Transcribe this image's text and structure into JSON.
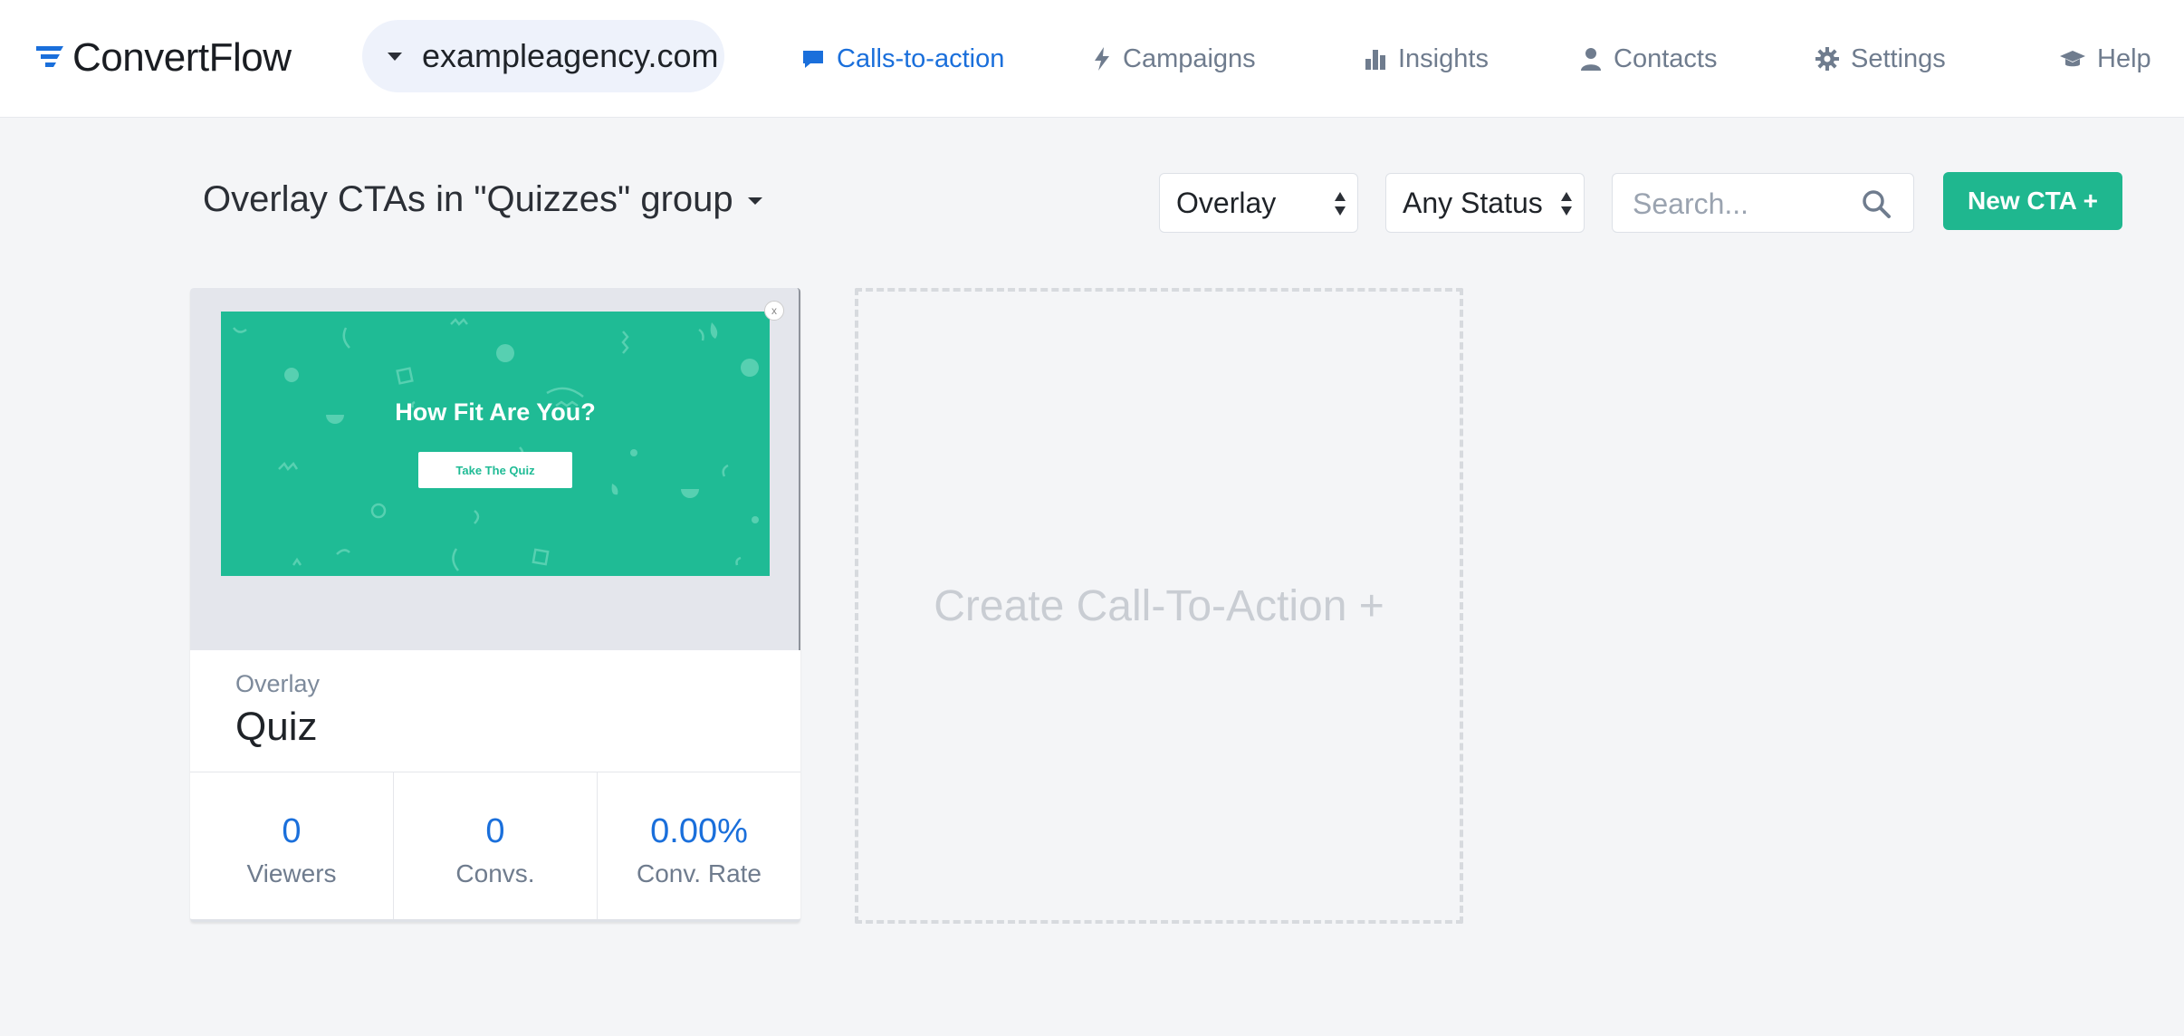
{
  "app": {
    "brand": "ConvertFlow"
  },
  "site_selector": {
    "value": "exampleagency.com"
  },
  "nav": {
    "items": [
      {
        "label": "Calls-to-action",
        "icon": "chat-bubble-icon",
        "active": true
      },
      {
        "label": "Campaigns",
        "icon": "lightning-icon",
        "active": false
      },
      {
        "label": "Insights",
        "icon": "bar-chart-icon",
        "active": false
      },
      {
        "label": "Contacts",
        "icon": "user-icon",
        "active": false
      },
      {
        "label": "Settings",
        "icon": "gear-icon",
        "active": false
      },
      {
        "label": "Help",
        "icon": "graduation-cap-icon",
        "active": false
      }
    ]
  },
  "toolbar": {
    "title": "Overlay CTAs in \"Quizzes\" group",
    "type_filter": "Overlay",
    "status_filter": "Any Status",
    "search_placeholder": "Search...",
    "new_button": "New CTA +"
  },
  "cards": [
    {
      "type": "Overlay",
      "name": "Quiz",
      "preview": {
        "headline": "How Fit Are You?",
        "button": "Take The Quiz",
        "close": "x",
        "background": "#1fbb95"
      },
      "stats": [
        {
          "value": "0",
          "label": "Viewers"
        },
        {
          "value": "0",
          "label": "Convs."
        },
        {
          "value": "0.00%",
          "label": "Conv. Rate"
        }
      ]
    }
  ],
  "create_placeholder": "Create Call-To-Action +",
  "colors": {
    "accent_blue": "#1a6fdb",
    "accent_green": "#1fb78f",
    "muted_text": "#6f7c8e"
  }
}
